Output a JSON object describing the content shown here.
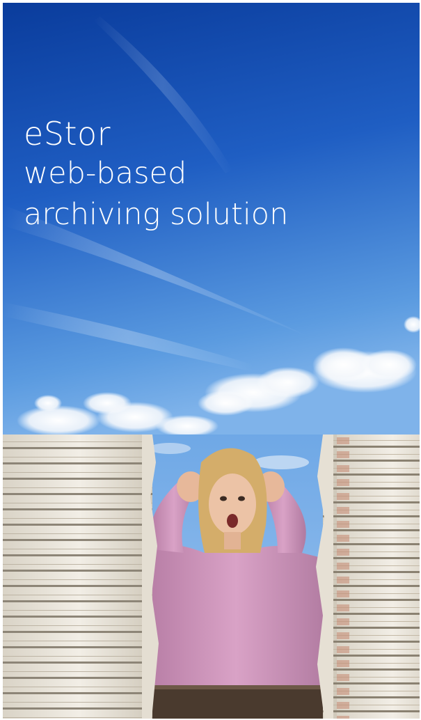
{
  "hero": {
    "title_line1": "eStor",
    "title_line2": "web-based",
    "title_line3": "archiving solution"
  },
  "images": {
    "sky": "sky-with-clouds-image",
    "scene": "woman-between-paper-stacks-image"
  },
  "colors": {
    "sky_top": "#0b3fa0",
    "sky_bottom": "#5d9fe3",
    "title_text": "#ffffff",
    "shirt": "#c98fb5",
    "hair": "#d9b46e",
    "paper": "#ece7dc"
  }
}
